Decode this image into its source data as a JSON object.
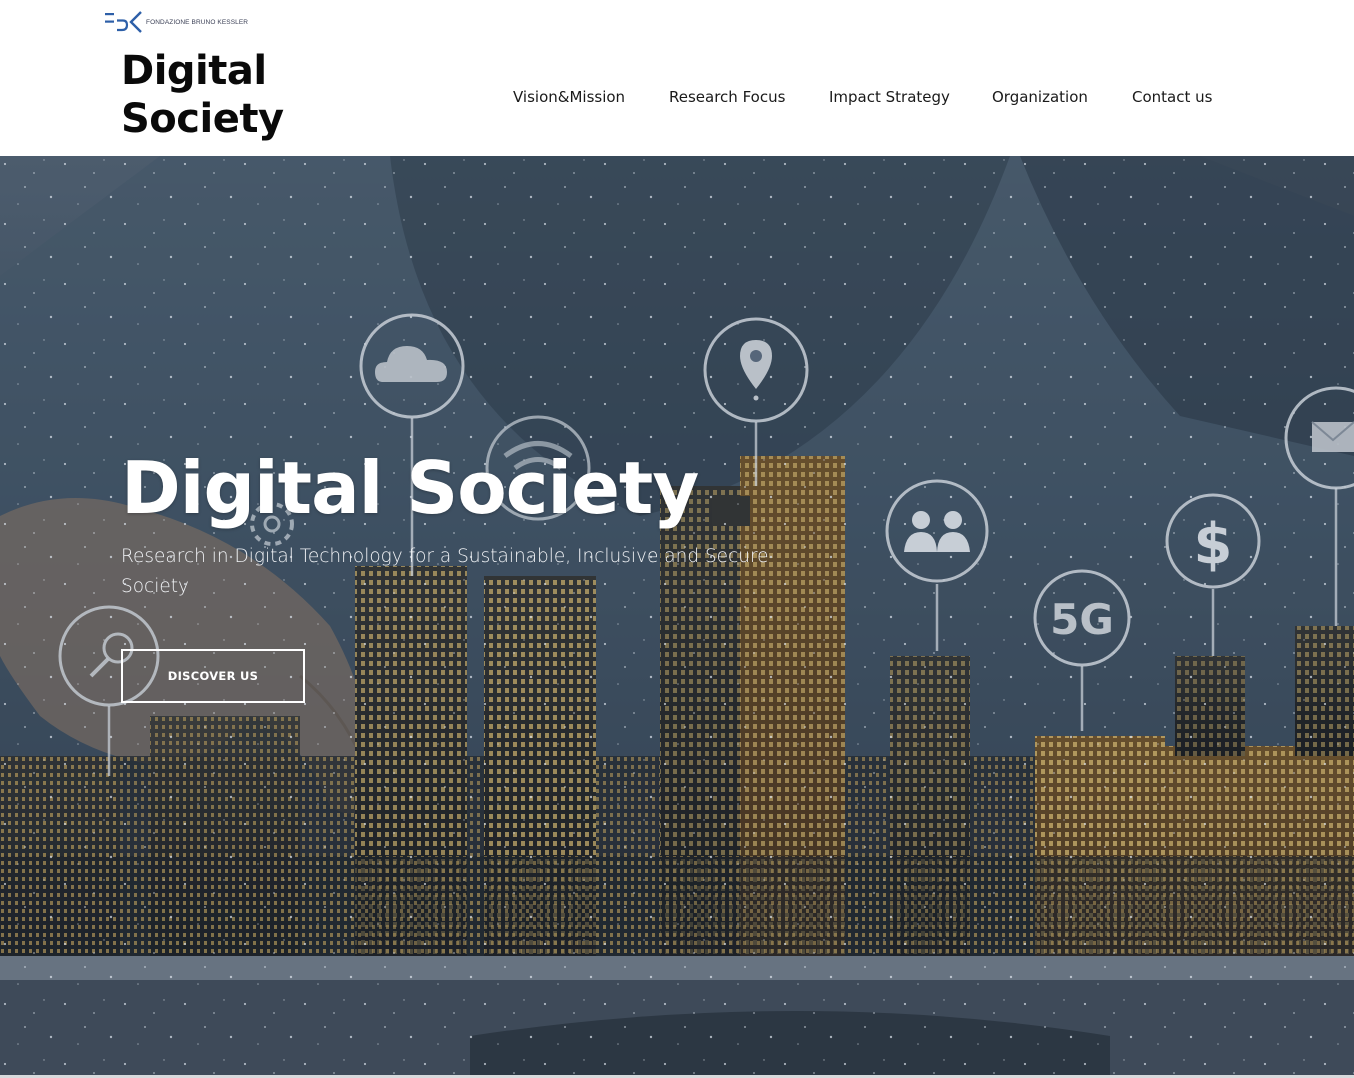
{
  "brand": {
    "org_name": "FONDAZIONE BRUNO KESSLER",
    "site_title_line1": "Digital",
    "site_title_line2": "Society"
  },
  "nav": {
    "items": [
      {
        "label": "Vision&Mission"
      },
      {
        "label": "Research Focus"
      },
      {
        "label": "Impact Strategy"
      },
      {
        "label": "Organization"
      },
      {
        "label": "Contact us"
      }
    ]
  },
  "hero": {
    "title": "Digital Society",
    "subtitle": "Research in Digital Technology for a Sustainable, Inclusive and Secure Society",
    "cta_label": "DISCOVER US",
    "overlay_icons": [
      "cloud-icon",
      "wifi-icon",
      "location-pin-icon",
      "people-icon",
      "dollar-icon",
      "5g-icon",
      "mail-icon",
      "gear-icon",
      "magnifier-icon"
    ],
    "icon_text_5g": "5G",
    "icon_text_dollar": "$"
  },
  "colors": {
    "header_bg": "#ffffff",
    "title_text": "#0a0a0a",
    "hero_text": "#ffffff",
    "fbk_blue": "#2d5fa8"
  }
}
